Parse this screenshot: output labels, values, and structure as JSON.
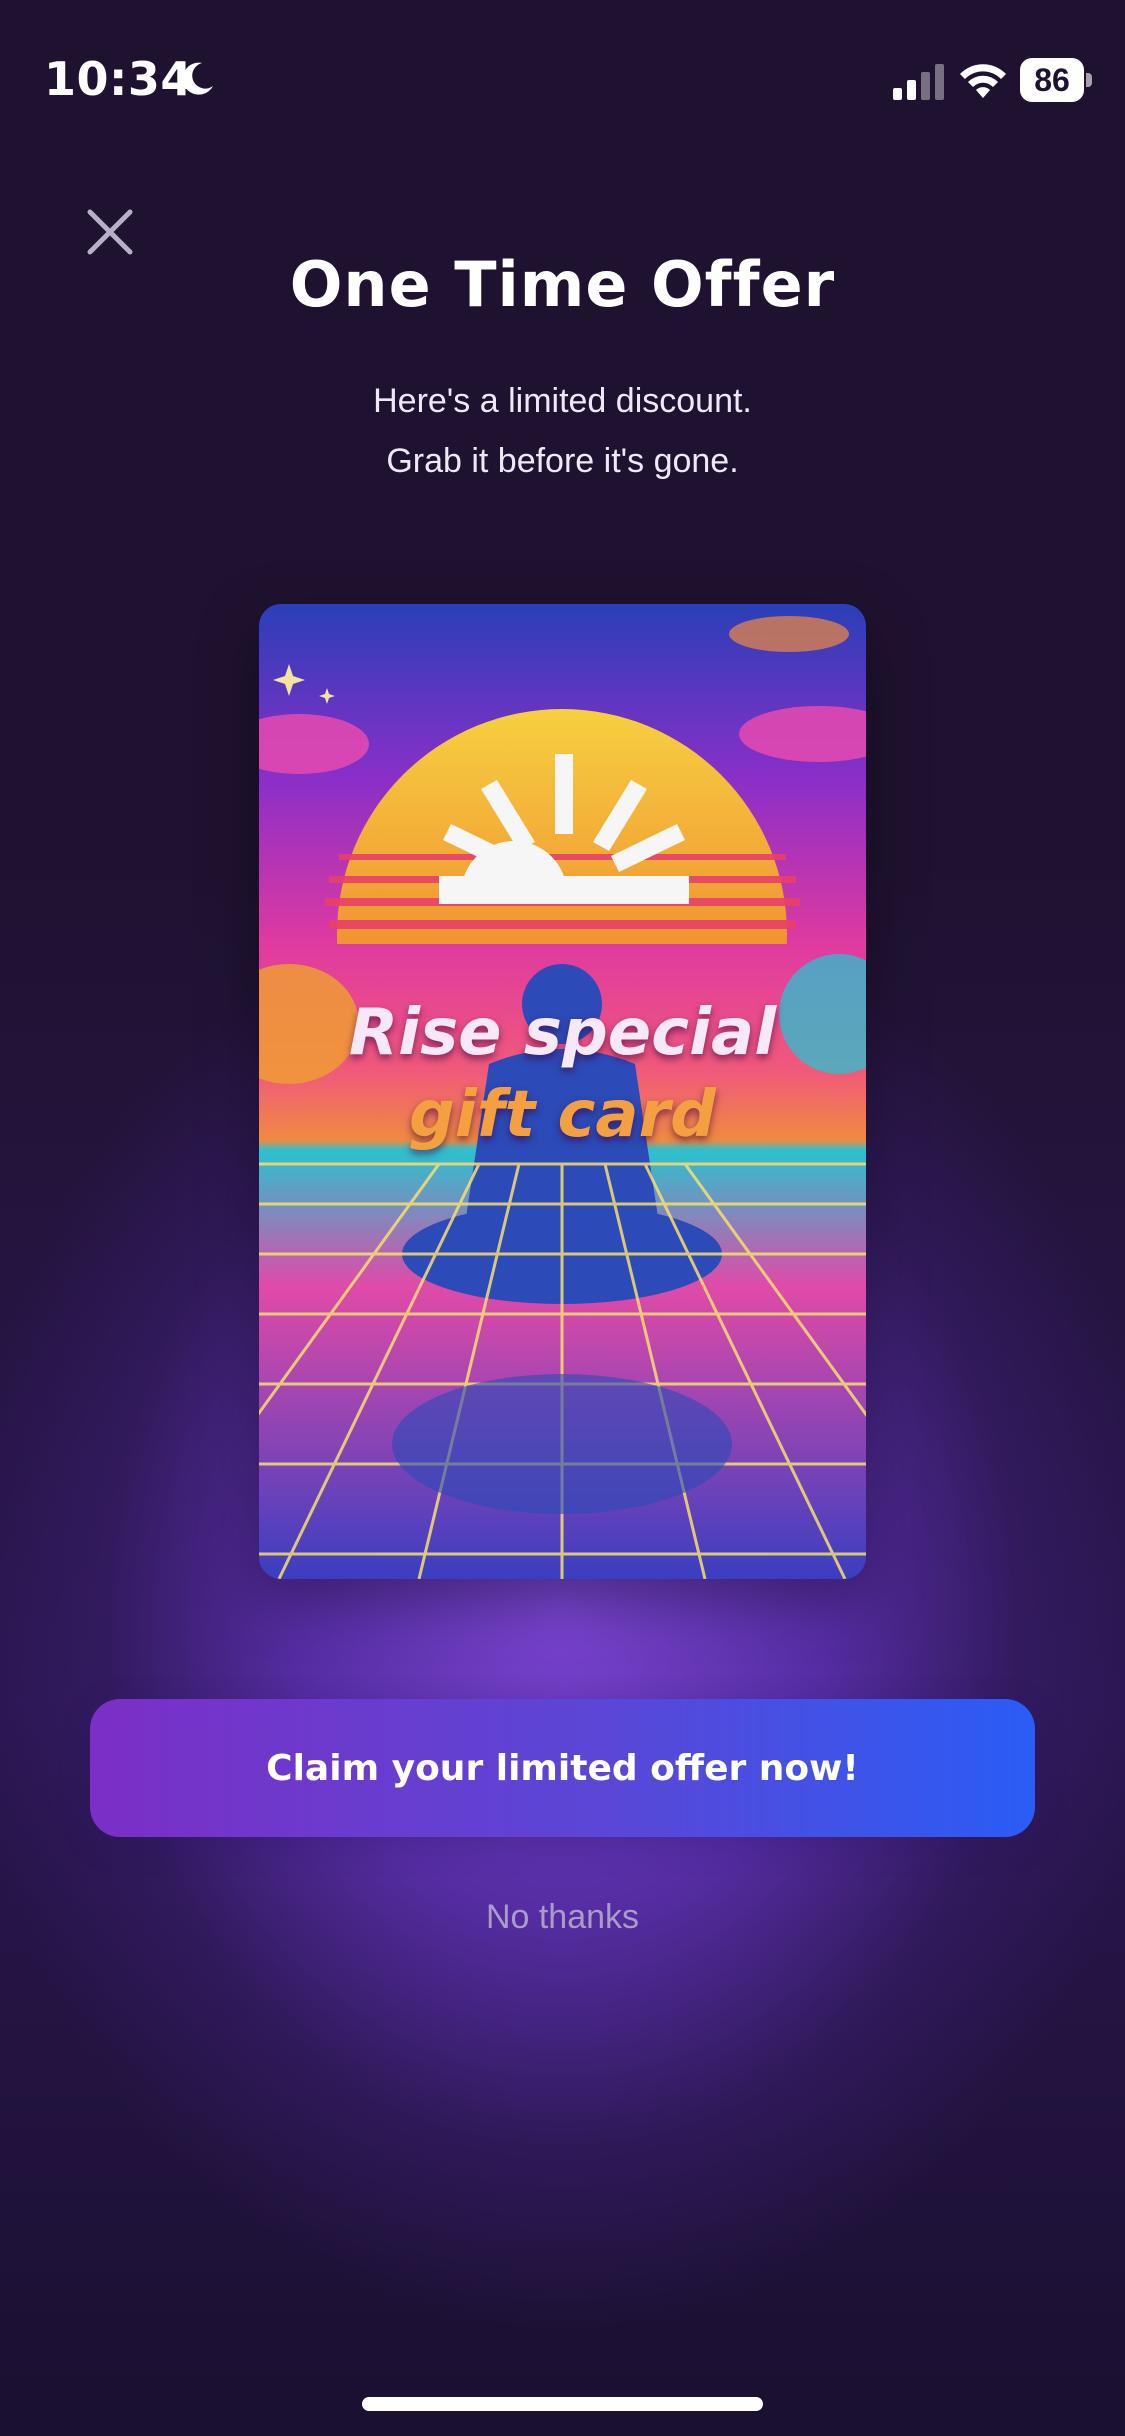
{
  "status_bar": {
    "time": "10:34",
    "battery_level": "86",
    "icons": [
      "moon-icon",
      "cellular-signal-icon",
      "wifi-icon",
      "battery-icon"
    ]
  },
  "close_icon": "close-icon",
  "header": {
    "title": "One Time Offer",
    "subtitle_line1": "Here's a limited discount.",
    "subtitle_line2": "Grab it before it's gone."
  },
  "gift_card": {
    "line1": "Rise special",
    "line2": "gift card",
    "logo": "sunrise-logo-icon"
  },
  "cta": {
    "label": "Claim your limited offer now!"
  },
  "dismiss": {
    "label": "No thanks"
  },
  "colors": {
    "background": "#1f1230",
    "glow": "#7c46d6",
    "cta_start": "#7b2fc6",
    "cta_end": "#2a5cf6",
    "dismiss_text": "#a99cc8"
  }
}
